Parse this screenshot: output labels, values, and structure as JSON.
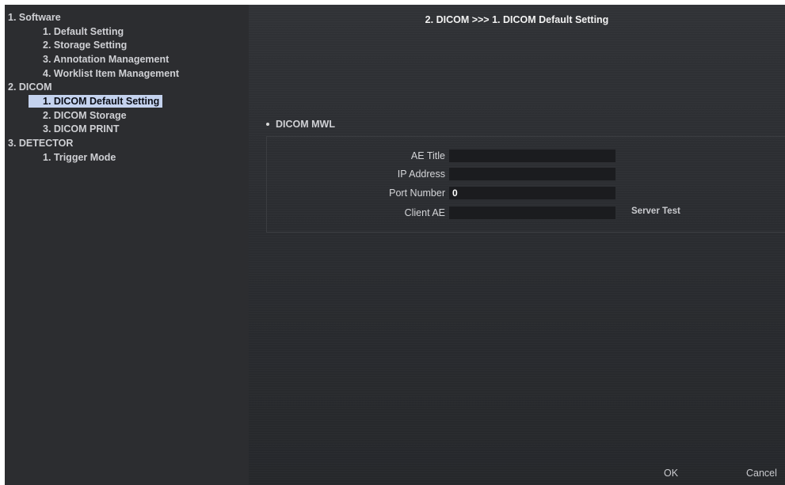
{
  "sidebar": {
    "items": [
      {
        "label": "1. Software"
      },
      {
        "label": "1. Default Setting"
      },
      {
        "label": "2. Storage Setting"
      },
      {
        "label": "3. Annotation Management"
      },
      {
        "label": "4. Worklist Item Management"
      },
      {
        "label": "2. DICOM"
      },
      {
        "label": "1. DICOM Default Setting",
        "selected": true
      },
      {
        "label": "2. DICOM Storage"
      },
      {
        "label": "3. DICOM PRINT"
      },
      {
        "label": "3. DETECTOR"
      },
      {
        "label": "1. Trigger Mode"
      }
    ]
  },
  "main": {
    "breadcrumb": "2. DICOM >>> 1. DICOM Default Setting",
    "section_title": "DICOM MWL",
    "fields": {
      "ae_title": {
        "label": "AE Title",
        "value": ""
      },
      "ip_address": {
        "label": "IP Address",
        "value": ""
      },
      "port_number": {
        "label": "Port Number",
        "value": "0"
      },
      "client_ae": {
        "label": "Client AE",
        "value": ""
      }
    },
    "server_test_label": "Server Test"
  },
  "footer": {
    "ok_label": "OK",
    "cancel_label": "Cancel"
  },
  "colors": {
    "selection_highlight": "#c4d2ee",
    "sidebar_bg": "#2c2d30",
    "panel_bg": "#2a2c30"
  }
}
